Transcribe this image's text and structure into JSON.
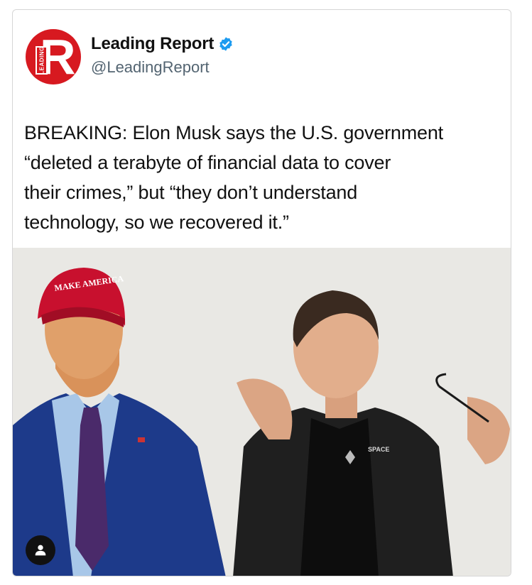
{
  "account": {
    "display_name": "Leading Report",
    "handle": "@LeadingReport",
    "verified_icon": "verified-badge-icon",
    "logo": {
      "letter": "R",
      "band_text": "LEADING",
      "color": "#d71920"
    }
  },
  "tweet": {
    "lines": [
      "BREAKING: Elon Musk says the U.S. government",
      "“deleted a terabyte of financial data to cover",
      "their crimes,” but “they don’t understand",
      "technology, so we recovered it.”"
    ]
  },
  "photo": {
    "hat_text": "MAKE AMERICA",
    "shirt_text": "SPACE",
    "background_color": "#e9e8e4"
  },
  "overlay": {
    "icon": "user-icon"
  },
  "colors": {
    "verified": "#1d9bf0",
    "text": "#111111",
    "handle": "#536471"
  }
}
